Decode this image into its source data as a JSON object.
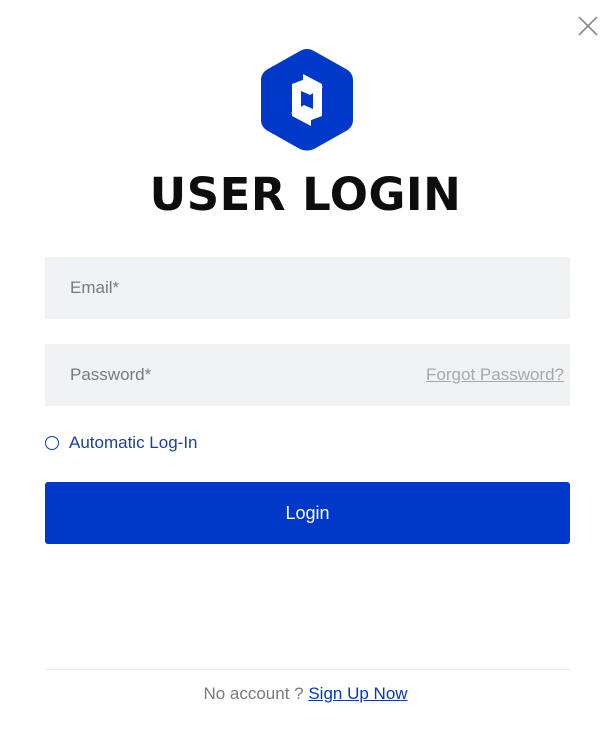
{
  "dialog": {
    "title": "USER LOGIN",
    "logo_icon": "hexagon-logo-icon",
    "close_icon": "close-icon"
  },
  "form": {
    "email_placeholder": "Email*",
    "email_value": "",
    "password_placeholder": "Password*",
    "password_value": "",
    "forgot_password": "Forgot Password?",
    "remember_label": "Automatic Log-In",
    "remember_checked": false,
    "login_label": "Login"
  },
  "footer": {
    "prompt": "No account ? ",
    "signup_label": "Sign Up Now"
  },
  "colors": {
    "brand": "#0038c9",
    "field_bg": "#f1f2f4",
    "title": "#0d0d0d"
  }
}
